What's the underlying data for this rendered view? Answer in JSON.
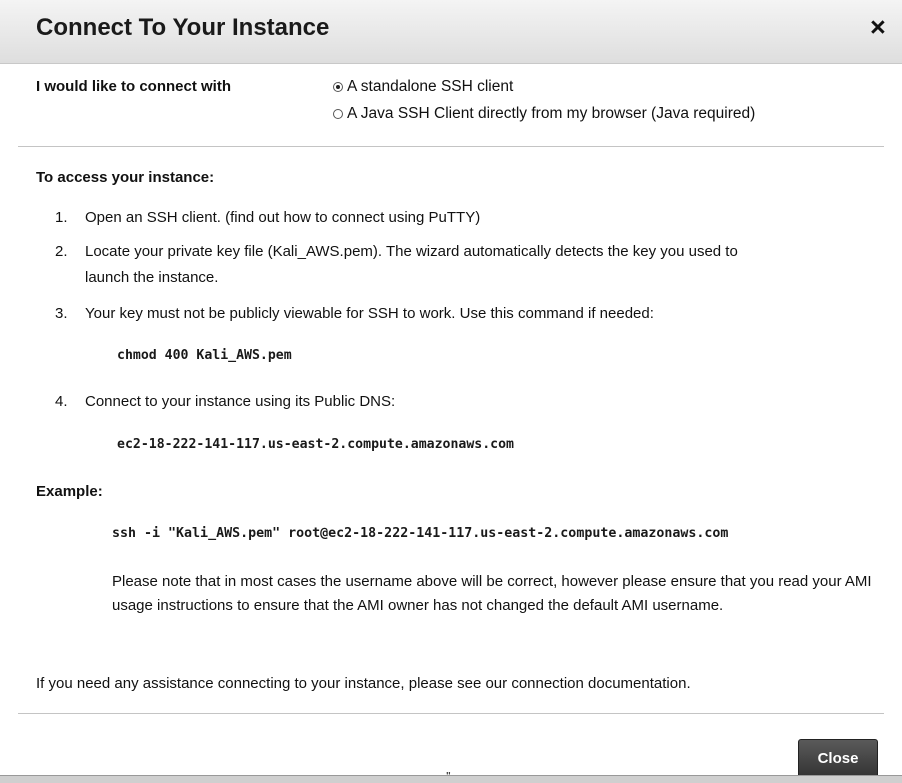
{
  "dialog": {
    "title": "Connect To Your Instance",
    "close_glyph": "×"
  },
  "connect": {
    "label": "I would like to connect with",
    "options": [
      {
        "label": "A standalone SSH client",
        "selected": true
      },
      {
        "label": "A Java SSH Client directly from my browser (Java required)",
        "selected": false
      }
    ]
  },
  "instructions": {
    "title": "To access your instance:",
    "step1": {
      "num": "1.",
      "text": "Open an SSH client. (find out how to connect using ",
      "link": "PuTTY",
      "after": ")"
    },
    "step2": {
      "num": "2.",
      "line1": "Locate your private key file (Kali_AWS.pem). The wizard automatically detects the key you used to",
      "line2": "launch the instance."
    },
    "step3": {
      "num": "3.",
      "text": "Your key must not be publicly viewable for SSH to work. Use this command if needed:",
      "command": "chmod 400 Kali_AWS.pem"
    },
    "step4": {
      "num": "4.",
      "text": "Connect to your instance using its Public DNS:",
      "dns": "ec2-18-222-141-117.us-east-2.compute.amazonaws.com"
    }
  },
  "example": {
    "label": "Example:",
    "command": "ssh -i \"Kali_AWS.pem\" root@ec2-18-222-141-117.us-east-2.compute.amazonaws.com",
    "note": "Please note that in most cases the username above will be correct, however please ensure that you read your AMI usage instructions to ensure that the AMI owner has not changed the default AMI username."
  },
  "help": {
    "text": "If you need any assistance connecting to your instance, please see our ",
    "link": "connection documentation",
    "after": "."
  },
  "footer": {
    "close_label": "Close",
    "grip": "\""
  }
}
